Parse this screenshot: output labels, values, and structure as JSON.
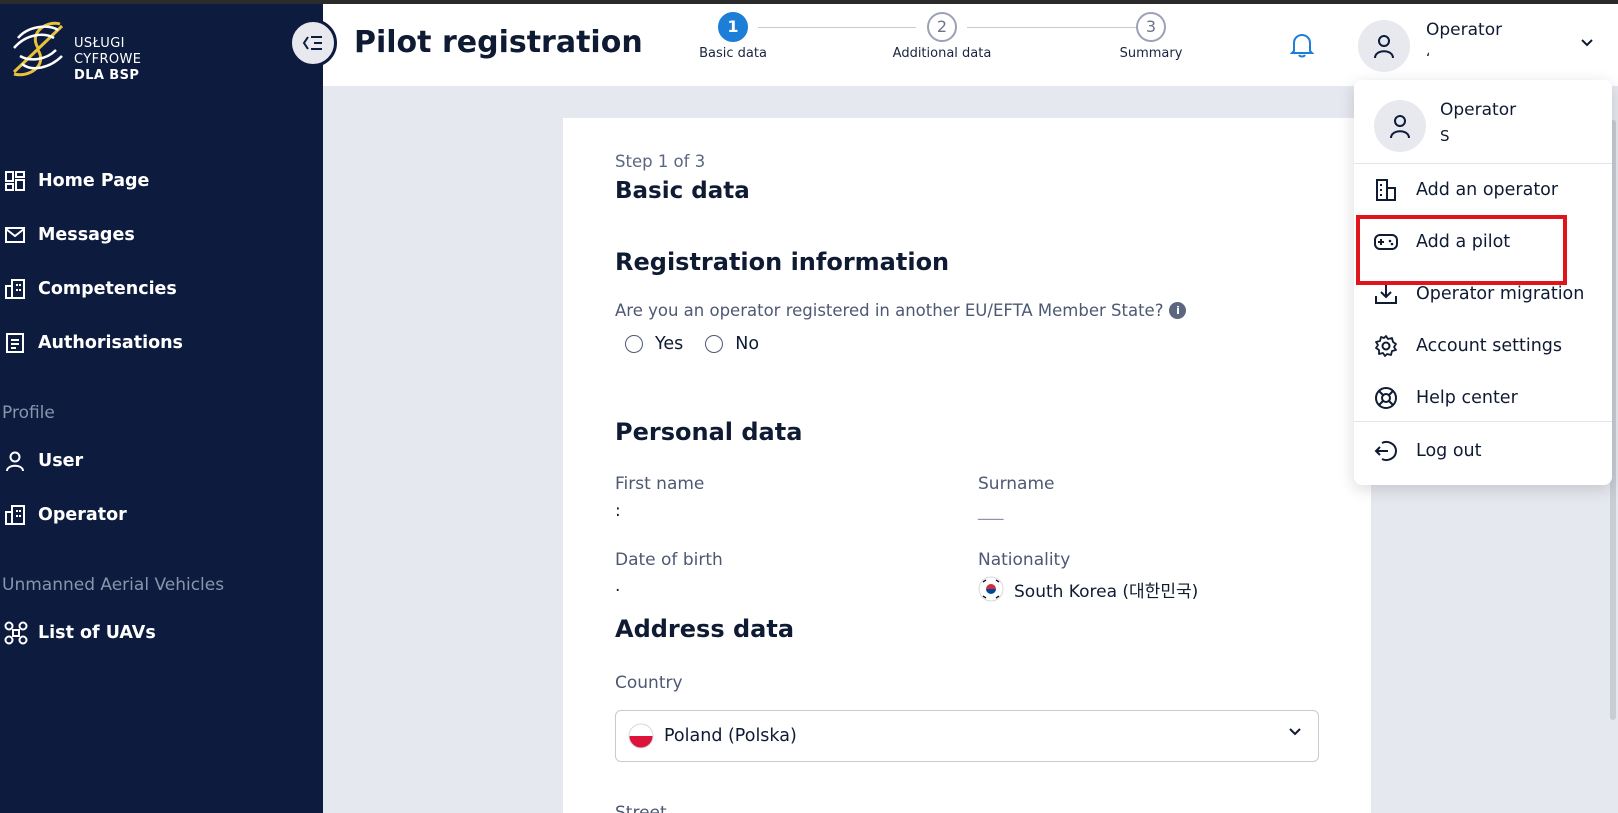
{
  "brand": {
    "line1": "USŁUGI",
    "line2": "CYFROWE",
    "line3": "DLA BSP"
  },
  "sidebar": {
    "items": [
      {
        "label": "Home Page",
        "icon": "dashboard-icon"
      },
      {
        "label": "Messages",
        "icon": "mail-icon"
      },
      {
        "label": "Competencies",
        "icon": "building-icon"
      },
      {
        "label": "Authorisations",
        "icon": "document-icon"
      }
    ],
    "profile_section": "Profile",
    "profile_items": [
      {
        "label": "User",
        "icon": "user-icon"
      },
      {
        "label": "Operator",
        "icon": "building-icon"
      }
    ],
    "uav_section": "Unmanned Aerial Vehicles",
    "uav_items": [
      {
        "label": "List of UAVs",
        "icon": "drone-icon"
      }
    ]
  },
  "header": {
    "title": "Pilot registration",
    "steps": [
      {
        "num": "1",
        "label": "Basic data",
        "active": true
      },
      {
        "num": "2",
        "label": "Additional data",
        "active": false
      },
      {
        "num": "3",
        "label": "Summary",
        "active": false
      }
    ],
    "user_name": "Operator",
    "user_sub": "ʻ"
  },
  "form": {
    "step_text": "Step 1 of 3",
    "step_title": "Basic data",
    "registration_heading": "Registration information",
    "question": "Are you an operator registered in another EU/EFTA Member State?",
    "option_yes": "Yes",
    "option_no": "No",
    "personal_heading": "Personal data",
    "first_name_label": "First name",
    "first_name_value": ":",
    "surname_label": "Surname",
    "surname_value": "___",
    "dob_label": "Date of birth",
    "dob_value": ".",
    "nationality_label": "Nationality",
    "nationality_value": "South Korea (대한민국)",
    "address_heading": "Address data",
    "country_label": "Country",
    "country_value": "Poland (Polska)",
    "street_label": "Street"
  },
  "dropdown": {
    "user_name": "Operator",
    "user_sub": "S",
    "items": [
      {
        "label": "Add an operator",
        "icon": "building-icon"
      },
      {
        "label": "Add a pilot",
        "icon": "gamepad-icon"
      },
      {
        "label": "Operator migration",
        "icon": "download-icon"
      },
      {
        "label": "Account settings",
        "icon": "gear-icon"
      },
      {
        "label": "Help center",
        "icon": "lifebuoy-icon"
      }
    ],
    "logout_label": "Log out"
  },
  "colors": {
    "sidebar_bg": "#0c1b3e",
    "accent": "#1c7ed6",
    "highlight": "#e0141b"
  }
}
